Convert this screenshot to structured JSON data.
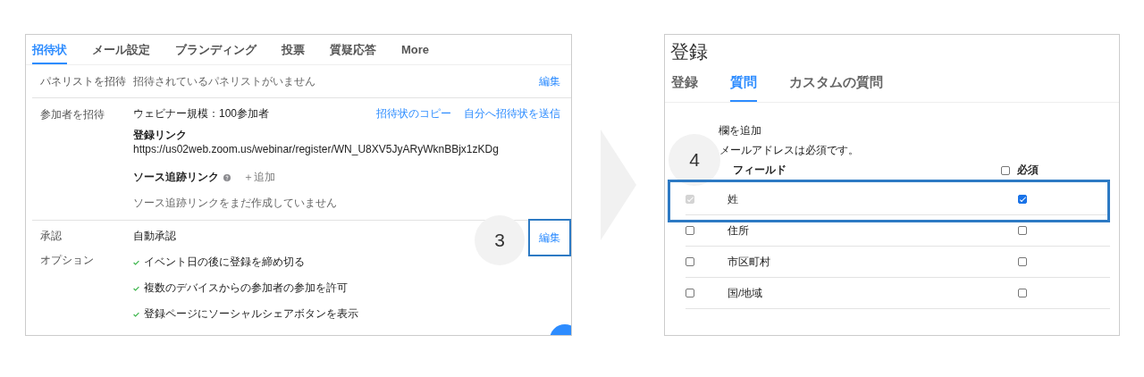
{
  "left_panel": {
    "tabs": [
      {
        "label": "招待状",
        "selected": true
      },
      {
        "label": "メール設定",
        "selected": false
      },
      {
        "label": "ブランディング",
        "selected": false
      },
      {
        "label": "投票",
        "selected": false
      },
      {
        "label": "質疑応答",
        "selected": false
      },
      {
        "label": "More",
        "selected": false
      }
    ],
    "panelists": {
      "label": "パネリストを招待",
      "value": "招待されているパネリストがいません",
      "edit": "編集"
    },
    "attendees": {
      "label": "参加者を招待",
      "capacity": "ウェビナー規模：100参加者",
      "links": [
        "招待状のコピー",
        "自分へ招待状を送信"
      ],
      "registration_link_label": "登録リンク",
      "registration_url": "https://us02web.zoom.us/webinar/register/WN_U8XV5JyARyWknBBjx1zKDg",
      "source_label": "ソース追跡リンク",
      "add": "＋追加",
      "source_empty": "ソース追跡リンクをまだ作成していません"
    },
    "approval": {
      "label": "承認",
      "value": "自動承認",
      "options_label": "オプション",
      "options": [
        {
          "text": "イベント日の後に登録を締め切る",
          "checked": true
        },
        {
          "text": "複数のデバイスからの参加者の参加を許可",
          "checked": true
        },
        {
          "text": "登録ページにソーシャルシェアボタンを表示",
          "checked": true
        }
      ],
      "edit": "編集",
      "edit_highlighted": true,
      "step": "3"
    }
  },
  "right_panel": {
    "title": "登録",
    "tabs": [
      {
        "label": "登録",
        "selected": false
      },
      {
        "label": "質問",
        "selected": true
      },
      {
        "label": "カスタムの質問",
        "selected": false
      }
    ],
    "add_field_label": "欄を追加",
    "note": "メールアドレスは必須です。",
    "step": "4",
    "columns": [
      "フィールド",
      "必須"
    ],
    "require_all_checked": false,
    "rows": [
      {
        "field": "姓",
        "included": true,
        "included_disabled": true,
        "required": true,
        "highlighted": true
      },
      {
        "field": "住所",
        "included": false,
        "included_disabled": false,
        "required": false,
        "highlighted": false
      },
      {
        "field": "市区町村",
        "included": false,
        "included_disabled": false,
        "required": false,
        "highlighted": false
      },
      {
        "field": "国/地域",
        "included": false,
        "included_disabled": false,
        "required": false,
        "highlighted": false
      }
    ]
  }
}
